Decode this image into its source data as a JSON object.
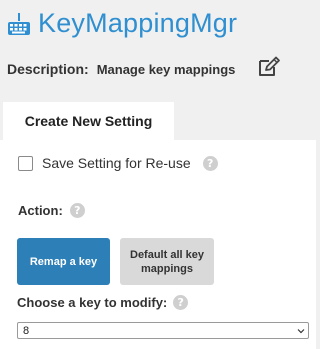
{
  "app": {
    "title": "KeyMappingMgr",
    "icon": "keyboard-icon",
    "accent_color": "#2f8fd0"
  },
  "description": {
    "label": "Description:",
    "value": "Manage key mappings",
    "edit_icon": "edit-icon"
  },
  "tabs": [
    {
      "label": "Create New Setting",
      "active": true
    }
  ],
  "save_setting": {
    "label": "Save Setting for Re-use",
    "checked": false,
    "help_icon": "?"
  },
  "action": {
    "label": "Action:",
    "help_icon": "?",
    "buttons": [
      {
        "label": "Remap a key",
        "color": "#2d7fb8"
      },
      {
        "label": "Default all key mappings",
        "color": "#d9d9d9"
      }
    ]
  },
  "choose_key": {
    "label": "Choose a key to modify:",
    "help_icon": "?",
    "selected": "8"
  }
}
